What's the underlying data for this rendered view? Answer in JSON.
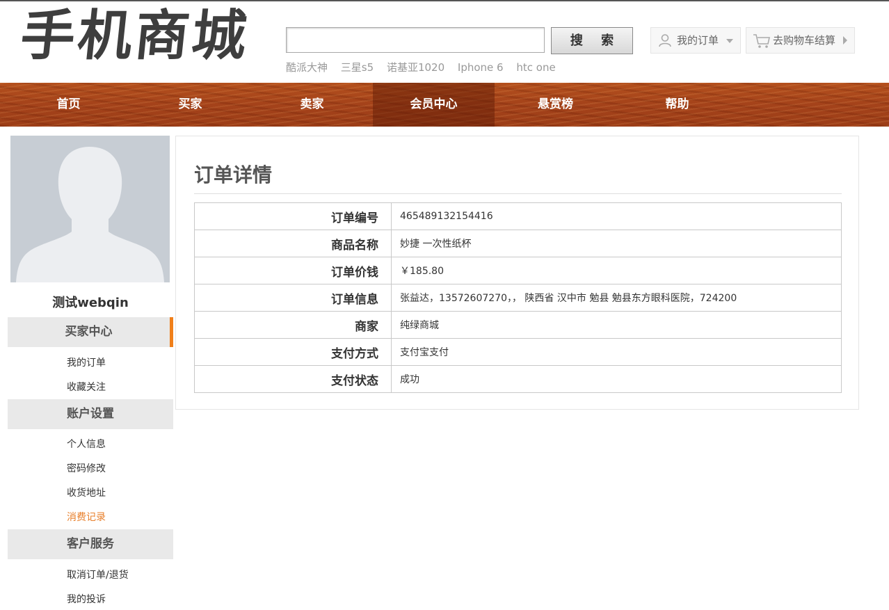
{
  "header": {
    "logo_text": "手机商城",
    "search": {
      "value": "",
      "placeholder": "",
      "button_label": "搜 索"
    },
    "hot_keywords": [
      "酷派大神",
      "三星s5",
      "诺基亚1020",
      "Iphone 6",
      "htc one"
    ],
    "my_orders_label": "我的订单",
    "cart_label": "去购物车结算"
  },
  "nav": {
    "items": [
      {
        "label": "首页"
      },
      {
        "label": "买家"
      },
      {
        "label": "卖家"
      },
      {
        "label": "会员中心"
      },
      {
        "label": "悬赏榜"
      },
      {
        "label": "帮助"
      }
    ],
    "active_index": 3
  },
  "sidebar": {
    "username": "测试webqin",
    "sections": [
      {
        "title": "买家中心",
        "links": [
          "我的订单",
          "收藏关注"
        ]
      },
      {
        "title": "账户设置",
        "links": [
          "个人信息",
          "密码修改",
          "收货地址",
          "消费记录"
        ]
      },
      {
        "title": "客户服务",
        "links": [
          "取消订单/退货",
          "我的投诉"
        ]
      }
    ],
    "current_link": "消费记录"
  },
  "main": {
    "title": "订单详情",
    "rows": [
      {
        "label": "订单编号",
        "value": "465489132154416"
      },
      {
        "label": "商品名称",
        "value": "妙捷 一次性纸杯"
      },
      {
        "label": "订单价钱",
        "value": "￥185.80"
      },
      {
        "label": "订单信息",
        "value": "张益达，13572607270，， 陕西省 汉中市 勉县 勉县东方眼科医院，724200"
      },
      {
        "label": "商家",
        "value": "纯绿商城"
      },
      {
        "label": "支付方式",
        "value": "支付宝支付"
      },
      {
        "label": "支付状态",
        "value": "成功"
      }
    ]
  },
  "colors": {
    "nav_wood": "#a4421a",
    "accent_orange": "#f07f1a",
    "current_link": "#e87f2a",
    "section_bg": "#e9e9e9"
  }
}
